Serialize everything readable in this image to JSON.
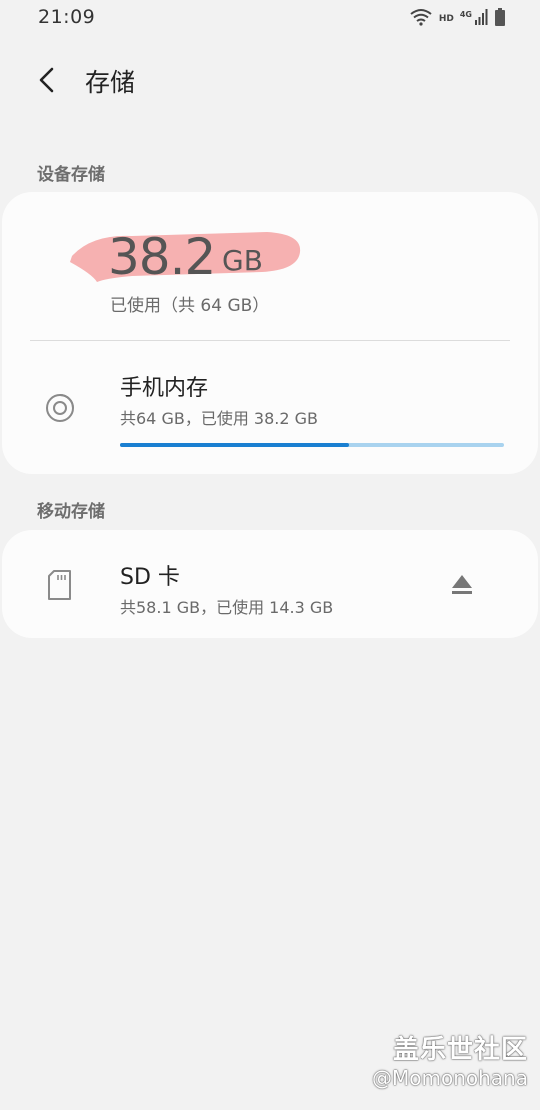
{
  "status_bar": {
    "time": "21:09",
    "hd_label": "HD",
    "network_label": "4G",
    "icons": [
      "wifi-icon",
      "signal-icon",
      "battery-icon"
    ]
  },
  "header": {
    "title": "存储",
    "back_icon": "back-arrow-icon"
  },
  "device_storage": {
    "section_title": "设备存储",
    "used_value": "38.2",
    "used_unit": "GB",
    "used_caption": "已使用（共 64 GB）",
    "items": [
      {
        "title": "手机内存",
        "subtitle": "共64 GB，已使用 38.2 GB",
        "icon": "storage-disc-icon",
        "usage_fraction": 0.597
      }
    ]
  },
  "mobile_storage": {
    "section_title": "移动存储",
    "items": [
      {
        "title": "SD 卡",
        "subtitle": "共58.1 GB，已使用 14.3 GB",
        "icon": "sd-card-icon",
        "action_icon": "eject-icon"
      }
    ]
  },
  "colors": {
    "background": "#f2f2f2",
    "card": "#fcfcfc",
    "progress_fill": "#1a7fd1",
    "progress_track": "#a9d3ef",
    "highlight": "#f4a3a3"
  },
  "watermark": {
    "brand": "盖乐世社区",
    "user": "@Momonohana"
  }
}
